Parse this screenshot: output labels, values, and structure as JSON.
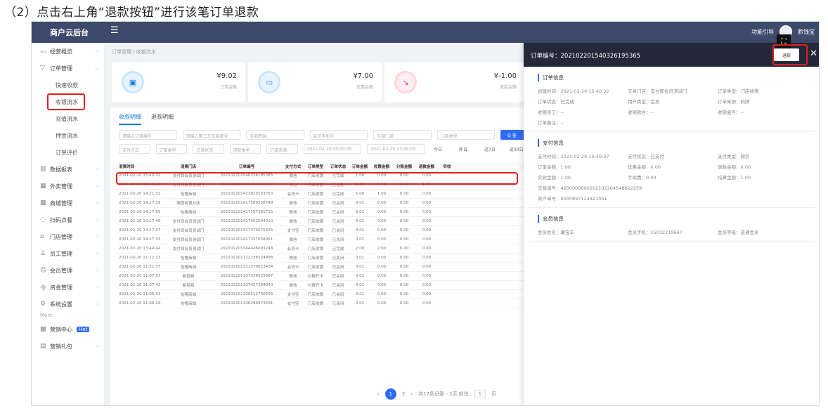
{
  "caption": "（2）点击右上角“退款按钮”进行该笔订单退款",
  "topbar": {
    "brand": "商户云后台",
    "menu_icon": "☰",
    "help_text": "功能引导",
    "user_text": "黔钱宝"
  },
  "sidebar": {
    "items": [
      {
        "icon": "〰",
        "label": "经营概览"
      },
      {
        "icon": "▽",
        "label": "订单管理",
        "expanded": true
      },
      {
        "icon": "",
        "label": "快速收款",
        "sub": true
      },
      {
        "icon": "",
        "label": "收银流水",
        "sub": true,
        "active": true
      },
      {
        "icon": "",
        "label": "充值流水",
        "sub": true
      },
      {
        "icon": "",
        "label": "押金流水",
        "sub": true
      },
      {
        "icon": "",
        "label": "订单评价",
        "sub": true
      },
      {
        "icon": "▥",
        "label": "数据报表"
      },
      {
        "icon": "▦",
        "label": "外卖管理"
      },
      {
        "icon": "▦",
        "label": "商城管理"
      },
      {
        "icon": "◌",
        "label": "扫码点餐"
      },
      {
        "icon": "⌂",
        "label": "门店管理"
      },
      {
        "icon": "♙",
        "label": "员工管理"
      },
      {
        "icon": "☺",
        "label": "会员管理"
      },
      {
        "icon": "令",
        "label": "资金管理"
      },
      {
        "icon": "⚙",
        "label": "系统设置"
      }
    ],
    "more_label": "More",
    "extra": [
      {
        "icon": "▩",
        "label": "营销中心",
        "badge": "Hot"
      },
      {
        "icon": "▤",
        "label": "营销礼包"
      }
    ]
  },
  "main": {
    "breadcrumb": "订单管理 / 收银流水",
    "cards": [
      {
        "amount": "¥9.02",
        "label": "订单金额"
      },
      {
        "amount": "¥7.00",
        "label": "优惠金额"
      },
      {
        "amount": "¥-1.00",
        "label": "退款金额"
      }
    ],
    "tabs": [
      "收款明细",
      "退款明细"
    ],
    "filters_row1": [
      "请输入订单编号",
      "请输入第三方交易单号",
      "全部终端",
      "会员手机号",
      "全部门店",
      "门店类型"
    ],
    "query_label": "Q 查询",
    "filters_row2": [
      "支付方式",
      "订单类型",
      "订单状态",
      "退款类型",
      "订单来源",
      "2021-02-20 00:00:00",
      "2021-02-20 23:59:59",
      "今日",
      "昨日",
      "近7日",
      "近30日"
    ],
    "headers": [
      "消费时间",
      "消费门店",
      "订单编号",
      "支付方式",
      "订单类型",
      "订单状态",
      "订单金额",
      "优惠金额",
      "分账金额",
      "退款金额",
      "实收"
    ],
    "rows": [
      [
        "2021-02-20 15:40:32",
        "支付即会员测试门",
        "202102201540326195365",
        "微信",
        "门店收银",
        "已完成",
        "1.00",
        "0.00",
        "0.00",
        "0.00",
        ""
      ],
      [
        "2021-02-20 15:38:18",
        "支付即会员测试门",
        "202102201538183463013",
        "微信",
        "门店收银",
        "已退款",
        "1.00",
        "0.00",
        "0.00",
        "1.00",
        ""
      ],
      [
        "2021-02-20 14:21:32",
        "怡橙商城",
        "202102201421829133763",
        "会员卡",
        "门店收银",
        "已完成",
        "5.00",
        "1.00",
        "0.00",
        "0.00",
        ""
      ],
      [
        "2021-02-20 14:17:59",
        "美团收银分店",
        "202102201417589258749",
        "微信",
        "门店收银",
        "已关闭",
        "0.01",
        "0.00",
        "0.00",
        "0.00",
        ""
      ],
      [
        "2021-02-20 14:17:55",
        "怡橙商城",
        "202102201417557381715",
        "微信",
        "门店收银",
        "已关闭",
        "0.01",
        "0.00",
        "0.00",
        "0.00",
        ""
      ],
      [
        "2021-02-20 14:17:40",
        "支付即会员测试门",
        "202102201417402004013",
        "微信",
        "门店收银",
        "已关闭",
        "0.01",
        "0.00",
        "0.00",
        "0.00",
        ""
      ],
      [
        "2021-02-20 14:17:37",
        "支付即会员测试门",
        "202102201417375675325",
        "支付宝",
        "门店收银",
        "已关闭",
        "0.01",
        "0.00",
        "0.00",
        "0.00",
        ""
      ],
      [
        "2021-02-20 14:17:33",
        "支付即会员测试门",
        "202102201417337058951",
        "微信",
        "门店收银",
        "已关闭",
        "0.01",
        "0.00",
        "0.00",
        "0.00",
        ""
      ],
      [
        "2021-02-20 13:44:44",
        "支付即会员测试门",
        "202102201344446093248",
        "会员卡",
        "门店收银",
        "已完成",
        "2.00",
        "2.00",
        "0.00",
        "0.00",
        ""
      ],
      [
        "2021-02-20 11:22:23",
        "怡橙商城",
        "202102201122238324998",
        "微信",
        "门店收银",
        "已关闭",
        "0.01",
        "0.00",
        "0.00",
        "0.00",
        ""
      ],
      [
        "2021-02-20 11:21:37",
        "怡橙商城",
        "202102201121370623404",
        "会员卡",
        "门店收银",
        "已关闭",
        "0.01",
        "0.00",
        "0.00",
        "0.00",
        ""
      ],
      [
        "2021-02-20 11:07:53",
        "新招商",
        "202102201107536525687",
        "微信",
        "付费开卡",
        "已关闭",
        "0.01",
        "0.00",
        "0.00",
        "0.00",
        ""
      ],
      [
        "2021-02-20 11:07:42",
        "新招商",
        "202102201107427384843",
        "微信",
        "付费开卡",
        "已关闭",
        "0.01",
        "0.00",
        "0.00",
        "0.00",
        ""
      ],
      [
        "2021-02-20 11:06:51",
        "怡橙商城",
        "202102201106512700556",
        "支付宝",
        "门店收银",
        "已关闭",
        "0.01",
        "0.00",
        "0.00",
        "0.00",
        ""
      ],
      [
        "2021-02-20 11:06:29",
        "怡橙商城",
        "202102201106296974591",
        "支付宝",
        "门店收银",
        "已关闭",
        "0.01",
        "0.00",
        "0.00",
        "0.00",
        ""
      ]
    ],
    "pager": {
      "prev": "‹",
      "page1": "1",
      "page2": "2",
      "next": "›",
      "total": "共17条记录 - 2页 前往",
      "goto": "1",
      "unit": "页"
    }
  },
  "detail": {
    "order_no": "订单编号：202102201540326195365",
    "refund_label": "退款",
    "close": "✕",
    "expand": "⛶",
    "order_info": {
      "title": "订单信息",
      "fields": [
        "创建时间：2021-02-20 15:40:32",
        "交易门店：支付即会员测试门",
        "订单类型：门店收银",
        "订单状态：已完成",
        "用户类型：会员",
        "订单来源：码牌",
        "收银员工：--",
        "收银款台：--",
        "收银盒号：--",
        "订单备注：--"
      ]
    },
    "pay_info": {
      "title": "支付信息",
      "fields": [
        "支付时间：2021-02-20 15:40:37",
        "支付状态：已支付",
        "支付类型：微信",
        "订单金额：1.00",
        "优惠金额：0.00",
        "退款金额：0.00",
        "实收金额：1.00",
        "手续费：0.00",
        "结算金额：1.00"
      ],
      "trade_no": "交易单号：4200000890202102204548622259",
      "merchant_no": "商户单号：0000897124821051"
    },
    "member_info": {
      "title": "会员信息",
      "fields": [
        "会员姓名：廉宝丰",
        "会员手机：15032219667",
        "会员等级：普通会员"
      ]
    }
  }
}
